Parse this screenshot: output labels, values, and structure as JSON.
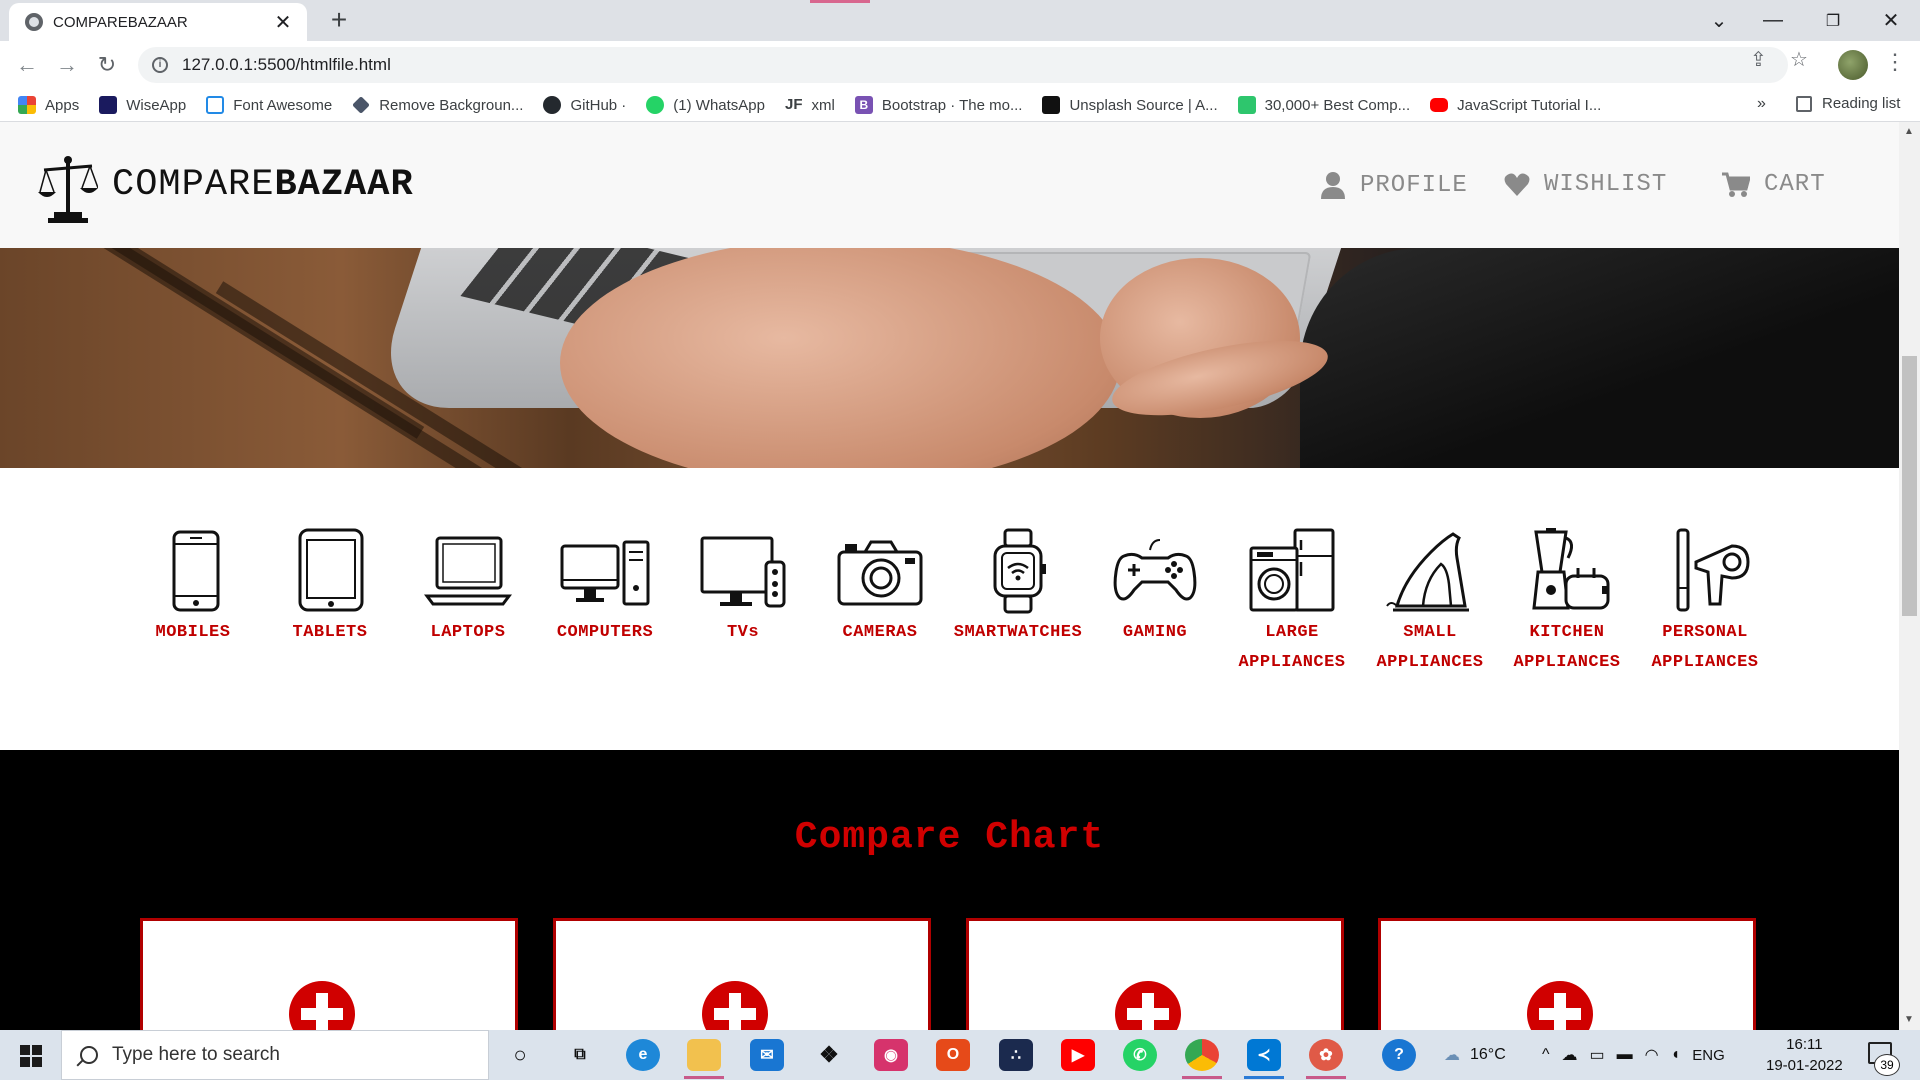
{
  "browser": {
    "tab_title": "COMPAREBAZAAR",
    "url": "127.0.0.1:5500/htmlfile.html",
    "bookmarks": [
      {
        "label": "Apps",
        "icon": "apps-grid-icon",
        "color": "#ea4335"
      },
      {
        "label": "WiseApp",
        "icon": "wiseapp-icon",
        "color": "#1a1a5e"
      },
      {
        "label": "Font Awesome",
        "icon": "flag-icon",
        "color": "#228ae6"
      },
      {
        "label": "Remove Backgroun...",
        "icon": "layers-icon",
        "color": "#4a5568"
      },
      {
        "label": "GitHub ·",
        "icon": "github-icon",
        "color": "#24292e"
      },
      {
        "label": "(1) WhatsApp",
        "icon": "whatsapp-icon",
        "color": "#25d366"
      },
      {
        "label": "xml",
        "icon": "jf-icon",
        "color": "#222222"
      },
      {
        "label": "Bootstrap · The mo...",
        "icon": "bootstrap-icon",
        "color": "#7952b3"
      },
      {
        "label": "Unsplash Source | A...",
        "icon": "unsplash-icon",
        "color": "#111111"
      },
      {
        "label": "30,000+ Best Comp...",
        "icon": "pixabay-icon",
        "color": "#2ec66d"
      },
      {
        "label": "JavaScript Tutorial I...",
        "icon": "youtube-icon",
        "color": "#ff0000"
      }
    ],
    "bookmarks_overflow": "»",
    "reading_list": "Reading list"
  },
  "site": {
    "brand_light": "COMPARE",
    "brand_bold": "BAZAAR",
    "nav": {
      "profile": "PROFILE",
      "wishlist": "WISHLIST",
      "cart": "CART"
    },
    "categories": [
      {
        "label": "MOBILES",
        "icon": "mobile-phone-icon"
      },
      {
        "label": "TABLETS",
        "icon": "tablet-icon"
      },
      {
        "label": "LAPTOPS",
        "icon": "laptop-icon"
      },
      {
        "label": "COMPUTERS",
        "icon": "desktop-computer-icon"
      },
      {
        "label": "TVs",
        "icon": "tv-icon"
      },
      {
        "label": "CAMERAS",
        "icon": "camera-icon"
      },
      {
        "label": "SMARTWATCHES",
        "icon": "smartwatch-icon"
      },
      {
        "label": "GAMING",
        "icon": "gamepad-icon"
      },
      {
        "label": "LARGE APPLIANCES",
        "icon": "washing-machine-icon"
      },
      {
        "label": "SMALL APPLIANCES",
        "icon": "iron-icon"
      },
      {
        "label": "KITCHEN APPLIANCES",
        "icon": "blender-toaster-icon"
      },
      {
        "label": "PERSONAL APPLIANCES",
        "icon": "hair-dryer-icon"
      }
    ],
    "compare_title": "Compare Chart",
    "accent_color": "#c00000"
  },
  "taskbar": {
    "search_placeholder": "Type here to search",
    "weather": "16°C",
    "language": "ENG",
    "time": "16:11",
    "date": "19-01-2022",
    "notification_count": "39"
  }
}
